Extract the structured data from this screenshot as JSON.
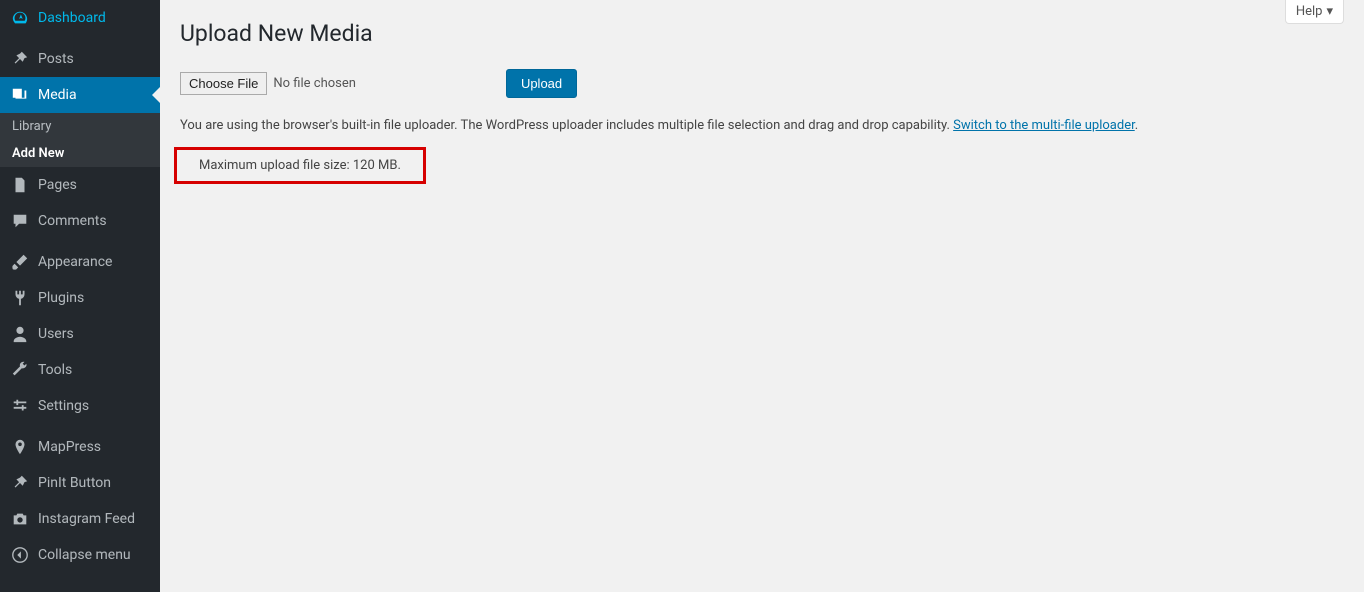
{
  "sidebar": {
    "dashboard": "Dashboard",
    "posts": "Posts",
    "media": "Media",
    "library": "Library",
    "addnew": "Add New",
    "pages": "Pages",
    "comments": "Comments",
    "appearance": "Appearance",
    "plugins": "Plugins",
    "users": "Users",
    "tools": "Tools",
    "settings": "Settings",
    "mappress": "MapPress",
    "pinit": "PinIt Button",
    "instagram": "Instagram Feed",
    "collapse": "Collapse menu"
  },
  "help": "Help",
  "page": {
    "title": "Upload New Media",
    "choose_file": "Choose File",
    "no_file": "No file chosen",
    "upload": "Upload",
    "info_text": "You are using the browser's built-in file uploader. The WordPress uploader includes multiple file selection and drag and drop capability. ",
    "switch_link": "Switch to the multi-file uploader",
    "info_period": ".",
    "max_upload": "Maximum upload file size: 120 MB."
  }
}
